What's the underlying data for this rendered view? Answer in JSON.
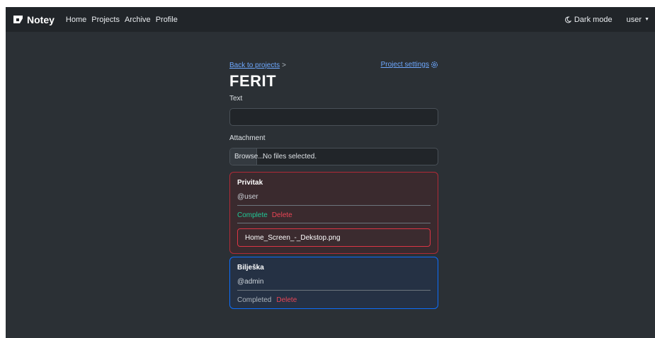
{
  "navbar": {
    "brand": "Notey",
    "links": [
      "Home",
      "Projects",
      "Archive",
      "Profile"
    ],
    "dark_mode_label": "Dark mode",
    "user_label": "user"
  },
  "breadcrumb": {
    "back_label": "Back to projects",
    "separator": ">",
    "settings_label": "Project settings"
  },
  "project_title": "FERIT",
  "form": {
    "text_label": "Text",
    "text_value": "",
    "attachment_label": "Attachment",
    "browse_label": "Browse...",
    "file_status": "No files selected."
  },
  "notes": [
    {
      "title": "Privitak",
      "author": "@user",
      "status_action": "Complete",
      "delete_label": "Delete",
      "attachment": "Home_Screen_-_Dekstop.png",
      "border_color": "#b02a37"
    },
    {
      "title": "Bilješka",
      "author": "@admin",
      "status_action": "Completed",
      "delete_label": "Delete",
      "border_color": "#0d6efd"
    }
  ],
  "icons": {
    "brand": "notey-logo-icon",
    "dark_mode": "moon-icon",
    "settings": "gear-icon",
    "user_menu": "caret-down-icon"
  },
  "colors": {
    "link": "#6ea8fe",
    "complete": "#20c997",
    "delete": "#ea4555"
  }
}
